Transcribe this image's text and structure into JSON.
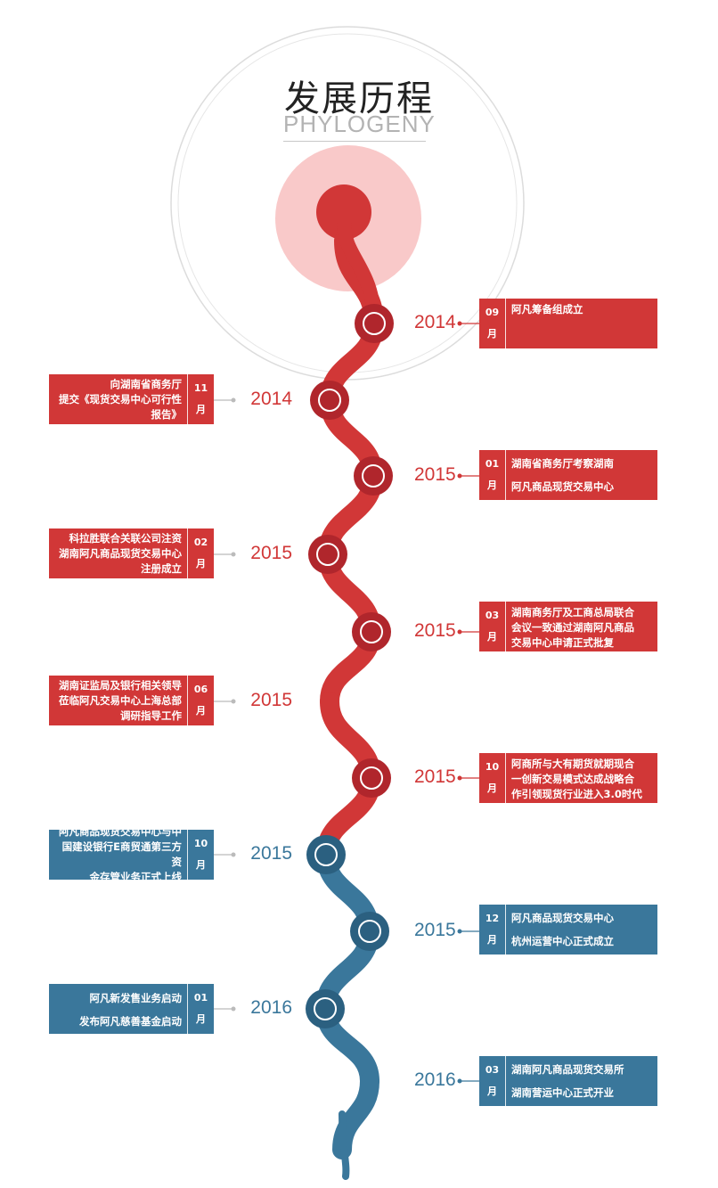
{
  "header": {
    "title": "发展历程",
    "subtitle": "PHYLOGENY"
  },
  "colors": {
    "red": "#d13737",
    "dark_red": "#b0262c",
    "blue": "#3a779b",
    "dark_blue": "#2b6080",
    "pink": "#f9c9c9"
  },
  "events": [
    {
      "side": "right",
      "year": "2014",
      "month": "09",
      "unit": "月",
      "color": "red",
      "lines": [
        "阿凡筹备组成立"
      ]
    },
    {
      "side": "left",
      "year": "2014",
      "month": "11",
      "unit": "月",
      "color": "red",
      "lines": [
        "向湖南省商务厅",
        "提交《现货交易中心可行性",
        "报告》"
      ]
    },
    {
      "side": "right",
      "year": "2015",
      "month": "01",
      "unit": "月",
      "color": "red",
      "lines": [
        "湖南省商务厅考察湖南",
        "阿凡商品现货交易中心"
      ]
    },
    {
      "side": "left",
      "year": "2015",
      "month": "02",
      "unit": "月",
      "color": "red",
      "lines": [
        "科拉胜联合关联公司注资",
        "湖南阿凡商品现货交易中心",
        "注册成立"
      ]
    },
    {
      "side": "right",
      "year": "2015",
      "month": "03",
      "unit": "月",
      "color": "red",
      "lines": [
        "湖南商务厅及工商总局联合",
        "会议一致通过湖南阿凡商品",
        "交易中心申请正式批复"
      ]
    },
    {
      "side": "left",
      "year": "2015",
      "month": "06",
      "unit": "月",
      "color": "red",
      "lines": [
        "湖南证监局及银行相关领导",
        "莅临阿凡交易中心上海总部",
        "调研指导工作"
      ]
    },
    {
      "side": "right",
      "year": "2015",
      "month": "10",
      "unit": "月",
      "color": "red",
      "lines": [
        "阿商所与大有期货就期现合",
        "一创新交易模式达成战略合",
        "作引领现货行业进入3.0时代"
      ]
    },
    {
      "side": "left",
      "year": "2015",
      "month": "10",
      "unit": "月",
      "color": "blue",
      "lines": [
        "阿凡商品现货交易中心与中",
        "国建设银行E商贸通第三方资",
        "金存管业务正式上线"
      ]
    },
    {
      "side": "right",
      "year": "2015",
      "month": "12",
      "unit": "月",
      "color": "blue",
      "lines": [
        "阿凡商品现货交易中心",
        "杭州运营中心正式成立"
      ]
    },
    {
      "side": "left",
      "year": "2016",
      "month": "01",
      "unit": "月",
      "color": "blue",
      "lines": [
        "阿凡新发售业务启动",
        "发布阿凡慈善基金启动"
      ]
    },
    {
      "side": "right",
      "year": "2016",
      "month": "03",
      "unit": "月",
      "color": "blue",
      "lines": [
        "湖南阿凡商品现货交易所",
        "湖南营运中心正式开业"
      ]
    }
  ]
}
